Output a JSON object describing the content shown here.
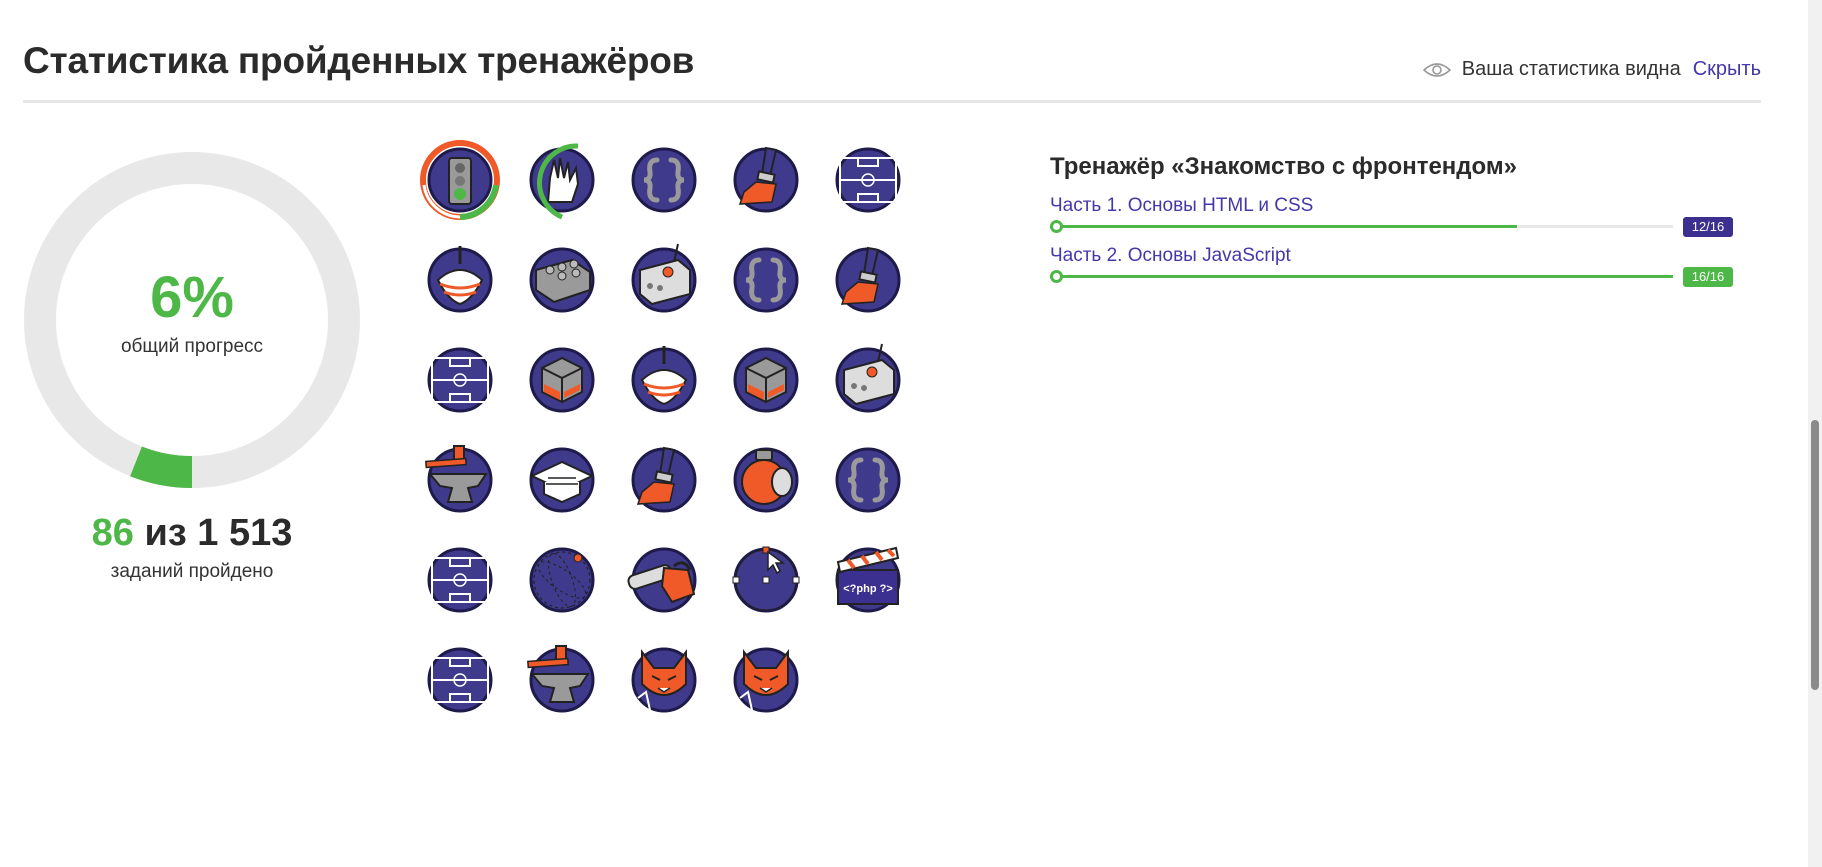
{
  "header": {
    "title": "Статистика пройденных тренажёров",
    "visibility_text": "Ваша статистика видна",
    "hide_label": "Скрыть"
  },
  "progress": {
    "percent_label": "6%",
    "percent_fraction": 0.06,
    "percent_caption": "общий прогресс",
    "done": "86",
    "of": "из 1 513",
    "caption": "заданий пройдено"
  },
  "colors": {
    "accent": "#4db847",
    "brand": "#4338a8",
    "badge_bg": "#3f3a8c",
    "orange": "#ef5a28"
  },
  "badges": [
    {
      "icon": "traffic-light-icon",
      "ring": "orange-green"
    },
    {
      "icon": "vulcan-hand-icon",
      "ring": "partial-green"
    },
    {
      "icon": "curly-braces-icon"
    },
    {
      "icon": "paint-brush-icon"
    },
    {
      "icon": "football-field-icon"
    },
    {
      "icon": "spinning-top-icon"
    },
    {
      "icon": "lego-brick-icon"
    },
    {
      "icon": "control-box-icon"
    },
    {
      "icon": "curly-braces-icon"
    },
    {
      "icon": "paint-brush-icon"
    },
    {
      "icon": "football-field-icon"
    },
    {
      "icon": "rubiks-cube-icon"
    },
    {
      "icon": "spinning-top-icon"
    },
    {
      "icon": "rubiks-cube-icon"
    },
    {
      "icon": "control-box-icon"
    },
    {
      "icon": "anvil-icon"
    },
    {
      "icon": "graduation-cap-icon"
    },
    {
      "icon": "paint-brush-icon"
    },
    {
      "icon": "diving-helmet-icon"
    },
    {
      "icon": "curly-braces-icon"
    },
    {
      "icon": "football-field-icon"
    },
    {
      "icon": "orbit-icon"
    },
    {
      "icon": "chainsaw-icon"
    },
    {
      "icon": "vector-cursor-icon"
    },
    {
      "icon": "php-clapper-icon",
      "text": "<?php ?>"
    },
    {
      "icon": "football-field-icon"
    },
    {
      "icon": "anvil-icon"
    },
    {
      "icon": "fox-icon"
    },
    {
      "icon": "fox-icon"
    }
  ],
  "trainer": {
    "title": "Тренажёр «Знакомство с фронтендом»",
    "parts": [
      {
        "label": "Часть 1. Основы HTML и CSS",
        "progress": "12/16",
        "fraction": 0.75,
        "complete": false
      },
      {
        "label": "Часть 2. Основы JavaScript",
        "progress": "16/16",
        "fraction": 1.0,
        "complete": true
      }
    ]
  }
}
